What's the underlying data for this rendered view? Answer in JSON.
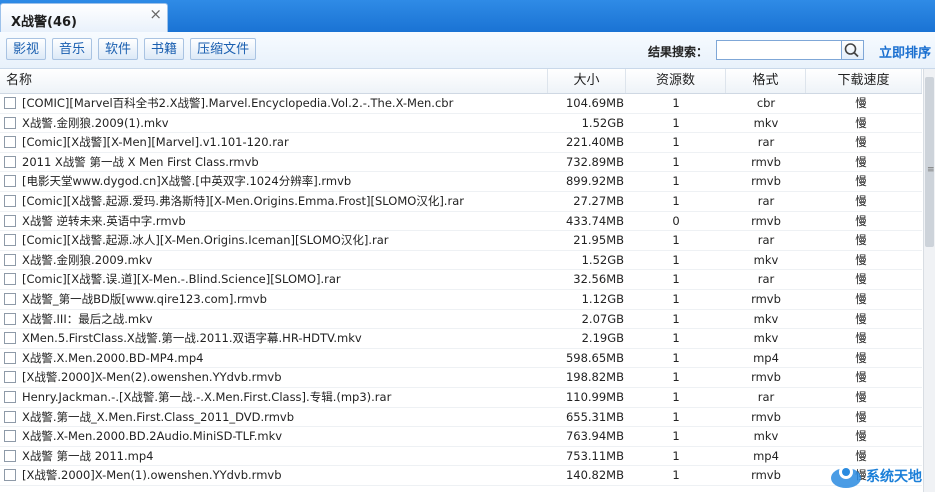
{
  "tab": {
    "title": "X战警(46)",
    "close": "×"
  },
  "filters": [
    "影视",
    "音乐",
    "软件",
    "书籍",
    "压缩文件"
  ],
  "search": {
    "label": "结果搜索：",
    "value": "",
    "sort_label": "立即排序"
  },
  "columns": {
    "name": "名称",
    "size": "大小",
    "sources": "资源数",
    "format": "格式",
    "speed": "下载速度"
  },
  "rows": [
    {
      "name": "[COMIC][Marvel百科全书2.X战警].Marvel.Encyclopedia.Vol.2.-.The.X-Men.cbr",
      "size": "104.69MB",
      "sources": "1",
      "format": "cbr",
      "speed": "慢"
    },
    {
      "name": "X战警.金刚狼.2009(1).mkv",
      "size": "1.52GB",
      "sources": "1",
      "format": "mkv",
      "speed": "慢"
    },
    {
      "name": "[Comic][X战警][X-Men][Marvel].v1.101-120.rar",
      "size": "221.40MB",
      "sources": "1",
      "format": "rar",
      "speed": "慢"
    },
    {
      "name": "2011 X战警 第一战 X Men First Class.rmvb",
      "size": "732.89MB",
      "sources": "1",
      "format": "rmvb",
      "speed": "慢"
    },
    {
      "name": "[电影天堂www.dygod.cn]X战警.[中英双字.1024分辨率].rmvb",
      "size": "899.92MB",
      "sources": "1",
      "format": "rmvb",
      "speed": "慢"
    },
    {
      "name": "[Comic][X战警.起源.爱玛.弗洛斯特][X-Men.Origins.Emma.Frost][SLOMO汉化].rar",
      "size": "27.27MB",
      "sources": "1",
      "format": "rar",
      "speed": "慢"
    },
    {
      "name": "X战警 逆转未来.英语中字.rmvb",
      "size": "433.74MB",
      "sources": "0",
      "format": "rmvb",
      "speed": "慢"
    },
    {
      "name": "[Comic][X战警.起源.冰人][X-Men.Origins.Iceman][SLOMO汉化].rar",
      "size": "21.95MB",
      "sources": "1",
      "format": "rar",
      "speed": "慢"
    },
    {
      "name": "X战警.金刚狼.2009.mkv",
      "size": "1.52GB",
      "sources": "1",
      "format": "mkv",
      "speed": "慢"
    },
    {
      "name": "[Comic][X战警.误.道][X-Men.-.Blind.Science][SLOMO].rar",
      "size": "32.56MB",
      "sources": "1",
      "format": "rar",
      "speed": "慢"
    },
    {
      "name": "X战警_第一战BD版[www.qire123.com].rmvb",
      "size": "1.12GB",
      "sources": "1",
      "format": "rmvb",
      "speed": "慢"
    },
    {
      "name": "X战警.III：最后之战.mkv",
      "size": "2.07GB",
      "sources": "1",
      "format": "mkv",
      "speed": "慢"
    },
    {
      "name": "XMen.5.FirstClass.X战警.第一战.2011.双语字幕.HR-HDTV.mkv",
      "size": "2.19GB",
      "sources": "1",
      "format": "mkv",
      "speed": "慢"
    },
    {
      "name": "X战警.X.Men.2000.BD-MP4.mp4",
      "size": "598.65MB",
      "sources": "1",
      "format": "mp4",
      "speed": "慢"
    },
    {
      "name": "[X战警.2000]X-Men(2).owenshen.YYdvb.rmvb",
      "size": "198.82MB",
      "sources": "1",
      "format": "rmvb",
      "speed": "慢"
    },
    {
      "name": "Henry.Jackman.-.[X战警.第一战.-.X.Men.First.Class].专辑.(mp3).rar",
      "size": "110.99MB",
      "sources": "1",
      "format": "rar",
      "speed": "慢"
    },
    {
      "name": "X战警.第一战_X.Men.First.Class_2011_DVD.rmvb",
      "size": "655.31MB",
      "sources": "1",
      "format": "rmvb",
      "speed": "慢"
    },
    {
      "name": "X战警.X-Men.2000.BD.2Audio.MiniSD-TLF.mkv",
      "size": "763.94MB",
      "sources": "1",
      "format": "mkv",
      "speed": "慢"
    },
    {
      "name": "X战警 第一战 2011.mp4",
      "size": "753.11MB",
      "sources": "1",
      "format": "mp4",
      "speed": "慢"
    },
    {
      "name": "[X战警.2000]X-Men(1).owenshen.YYdvb.rmvb",
      "size": "140.82MB",
      "sources": "1",
      "format": "rmvb",
      "speed": "慢"
    }
  ],
  "watermark": "系统天地",
  "icons": {
    "search": "search-icon",
    "close": "close-icon",
    "checkbox": "checkbox-icon"
  },
  "colors": {
    "tab_bar": "#1a73d4",
    "link": "#1a6fd0",
    "filter_text": "#1a5fb0"
  }
}
